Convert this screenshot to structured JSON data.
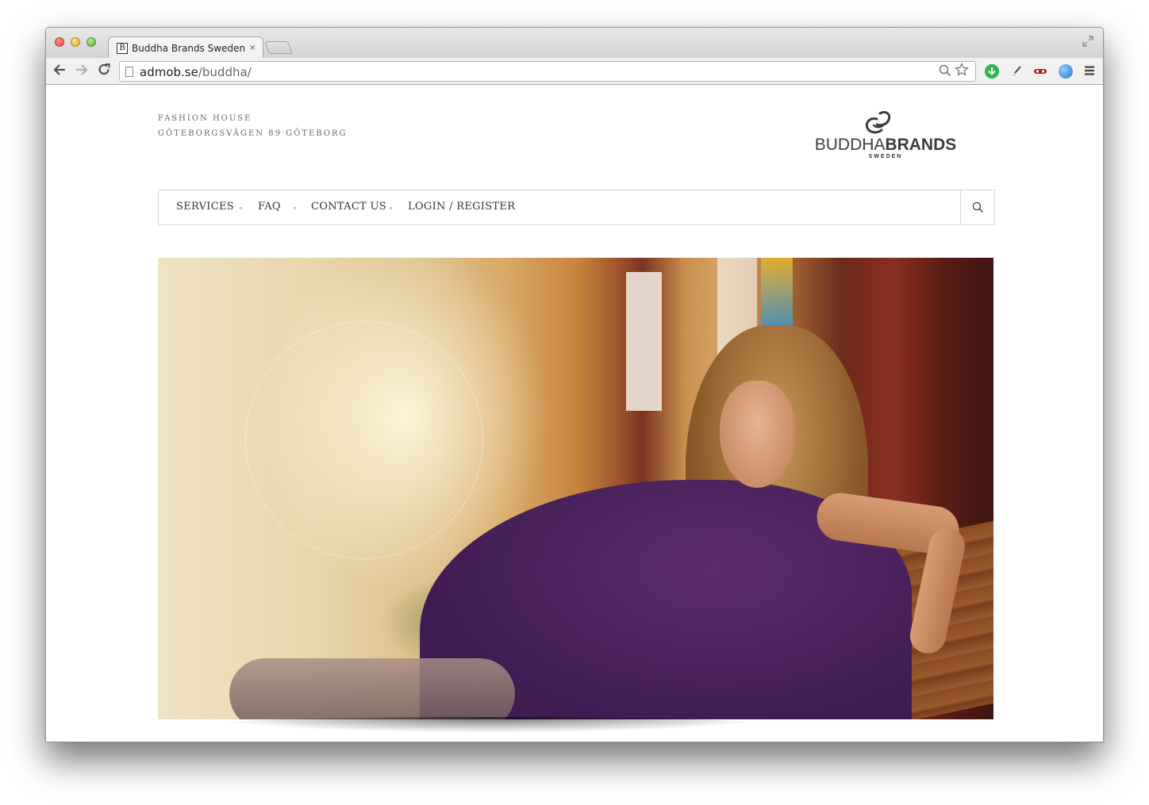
{
  "browser": {
    "tab_title": "Buddha Brands Sweden",
    "tab_favicon_letter": "B",
    "tab_close_glyph": "×",
    "url_host": "admob.se",
    "url_path": "/buddha/",
    "extensions": [
      "download-icon",
      "brush-icon",
      "mask-icon",
      "globe-icon",
      "menu-icon"
    ]
  },
  "header": {
    "tagline_line1": "Fashion House",
    "tagline_line2": "Göteborgsvägen 89 Göteborg",
    "logo": {
      "word_left": "BUDDHA",
      "word_right": "BRANDS",
      "sub": "SWEDEN"
    }
  },
  "nav": {
    "items": [
      {
        "label": "SERVICES"
      },
      {
        "label": "FAQ"
      },
      {
        "label": "CONTACT US"
      },
      {
        "label": "LOGIN / REGISTER"
      }
    ],
    "search_icon": "search-icon"
  },
  "hero": {
    "image": "woman-in-purple-dress-leaning-on-bench"
  },
  "colors": {
    "text_dark": "#333333",
    "border": "#d6d6d6",
    "dress_purple": "#4a2060"
  }
}
